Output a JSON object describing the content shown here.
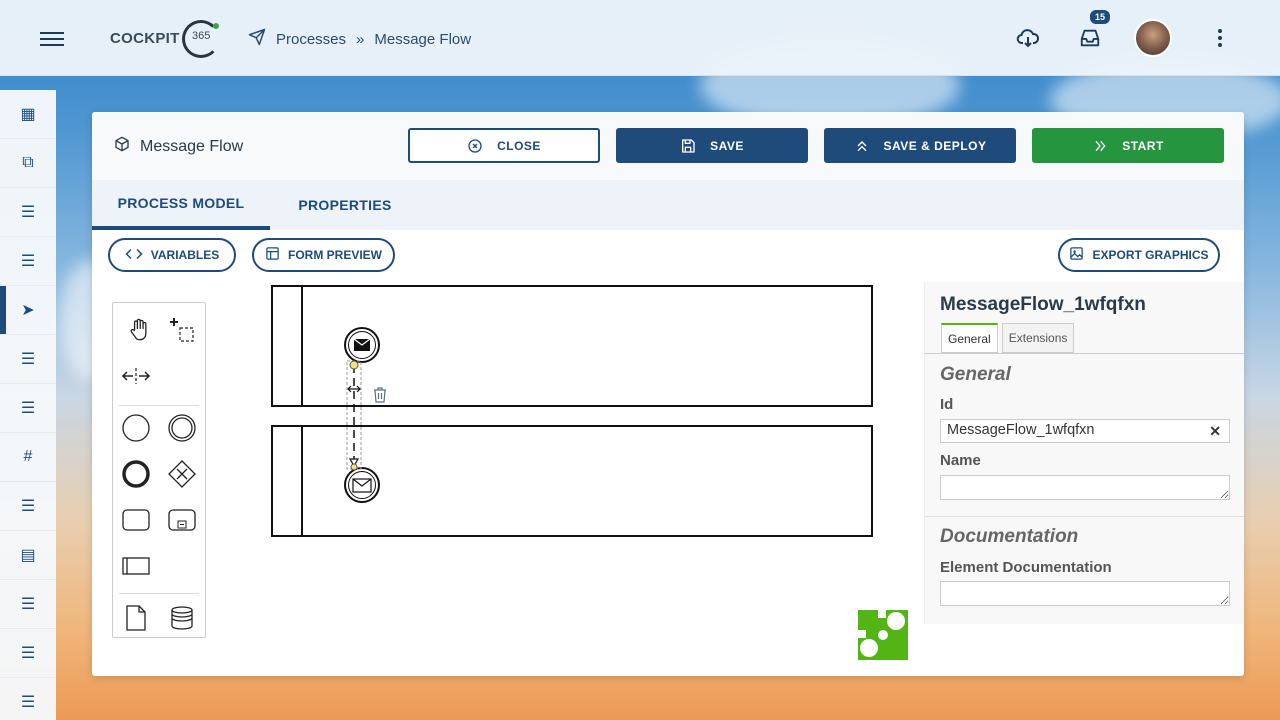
{
  "app": {
    "logo_text": "COCKPIT",
    "logo_number": "365",
    "brand_colors": {
      "primary": "#1e4b7a",
      "green": "#25963f",
      "accent": "#52b415"
    }
  },
  "header": {
    "breadcrumb": [
      "Processes",
      "Message Flow"
    ],
    "breadcrumb_separator": "»",
    "inbox_badge": "15"
  },
  "sidebar": {
    "items": [
      {
        "icon": "dashboard-icon",
        "glyph": "▦"
      },
      {
        "icon": "cube-icon",
        "glyph": "⧉"
      },
      {
        "icon": "list-icon",
        "glyph": "☰"
      },
      {
        "icon": "list-icon",
        "glyph": "☰"
      },
      {
        "icon": "paper-plane-icon",
        "glyph": "➤",
        "active": true
      },
      {
        "icon": "list-icon",
        "glyph": "☰"
      },
      {
        "icon": "list-icon",
        "glyph": "☰"
      },
      {
        "icon": "hash-icon",
        "glyph": "#"
      },
      {
        "icon": "list-icon",
        "glyph": "☰"
      },
      {
        "icon": "calendar-list-icon",
        "glyph": "▤"
      },
      {
        "icon": "list-icon",
        "glyph": "☰"
      },
      {
        "icon": "list-icon",
        "glyph": "☰"
      },
      {
        "icon": "list-icon",
        "glyph": "☰"
      }
    ]
  },
  "card": {
    "title": "Message Flow",
    "buttons": {
      "close": "CLOSE",
      "save": "SAVE",
      "deploy": "SAVE & DEPLOY",
      "start": "START"
    },
    "tabs": [
      "PROCESS MODEL",
      "PROPERTIES"
    ],
    "actions": {
      "variables": "VARIABLES",
      "form_preview": "FORM PREVIEW",
      "export": "EXPORT GRAPHICS"
    }
  },
  "properties": {
    "element_id_title": "MessageFlow_1wfqfxn",
    "tabs": [
      "General",
      "Extensions"
    ],
    "section_general": "General",
    "id_label": "Id",
    "id_value": "MessageFlow_1wfqfxn",
    "name_label": "Name",
    "name_value": "",
    "section_documentation": "Documentation",
    "documentation_label": "Element Documentation",
    "documentation_value": ""
  }
}
